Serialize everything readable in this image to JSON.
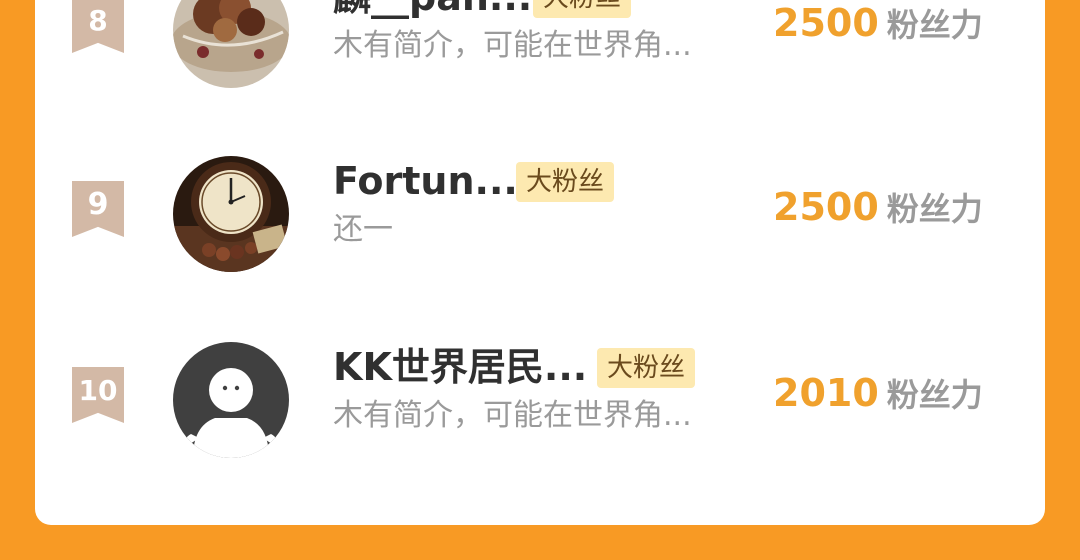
{
  "rows": [
    {
      "rank": "8",
      "name": "麟__pan...",
      "badge": "大粉丝",
      "bio": "木有简介，可能在世界角...",
      "score": "2500",
      "unit": "粉丝力",
      "avatar": "photo-dried-flowers"
    },
    {
      "rank": "9",
      "name": "Fortun...",
      "badge": "大粉丝",
      "bio": "还一",
      "score": "2500",
      "unit": "粉丝力",
      "avatar": "photo-clock"
    },
    {
      "rank": "10",
      "name": "KK世界居民...",
      "badge": "大粉丝",
      "bio": "木有简介，可能在世界角...",
      "score": "2010",
      "unit": "粉丝力",
      "avatar": "default-avatar-icon"
    }
  ],
  "colors": {
    "background": "#f89a24",
    "rank_ribbon": "#d3b9a6",
    "badge_bg": "#fde9b0",
    "score": "#f0a12d"
  }
}
